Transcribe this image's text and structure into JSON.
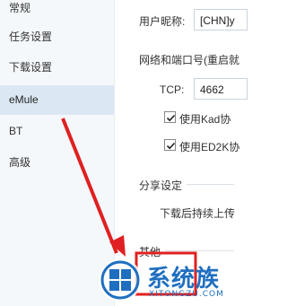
{
  "sidebar": {
    "items": [
      {
        "label": "常规"
      },
      {
        "label": "任务设置"
      },
      {
        "label": "下载设置"
      },
      {
        "label": "eMule"
      },
      {
        "label": "BT"
      },
      {
        "label": "高级"
      }
    ],
    "active_index": 3
  },
  "main": {
    "nickname_label": "用户昵称:",
    "nickname_value": "[CHN]y",
    "network_label": "网络和端口号(重启就",
    "tcp_label": "TCP:",
    "tcp_value": "4662",
    "kad_label": "使用Kad协",
    "ed2k_label": "使用ED2K协",
    "share_section": "分享设定",
    "share_option": "下载后持续上传",
    "other_section": "其他"
  },
  "watermark": {
    "brand_text": "系统族",
    "site_text": "XITONGZU.COM"
  },
  "colors": {
    "sidebar_bg": "#f4f8fb",
    "active_bg": "#dbe8f3",
    "annotation_red": "#e02020",
    "watermark_blue": "#1f6fc0"
  }
}
